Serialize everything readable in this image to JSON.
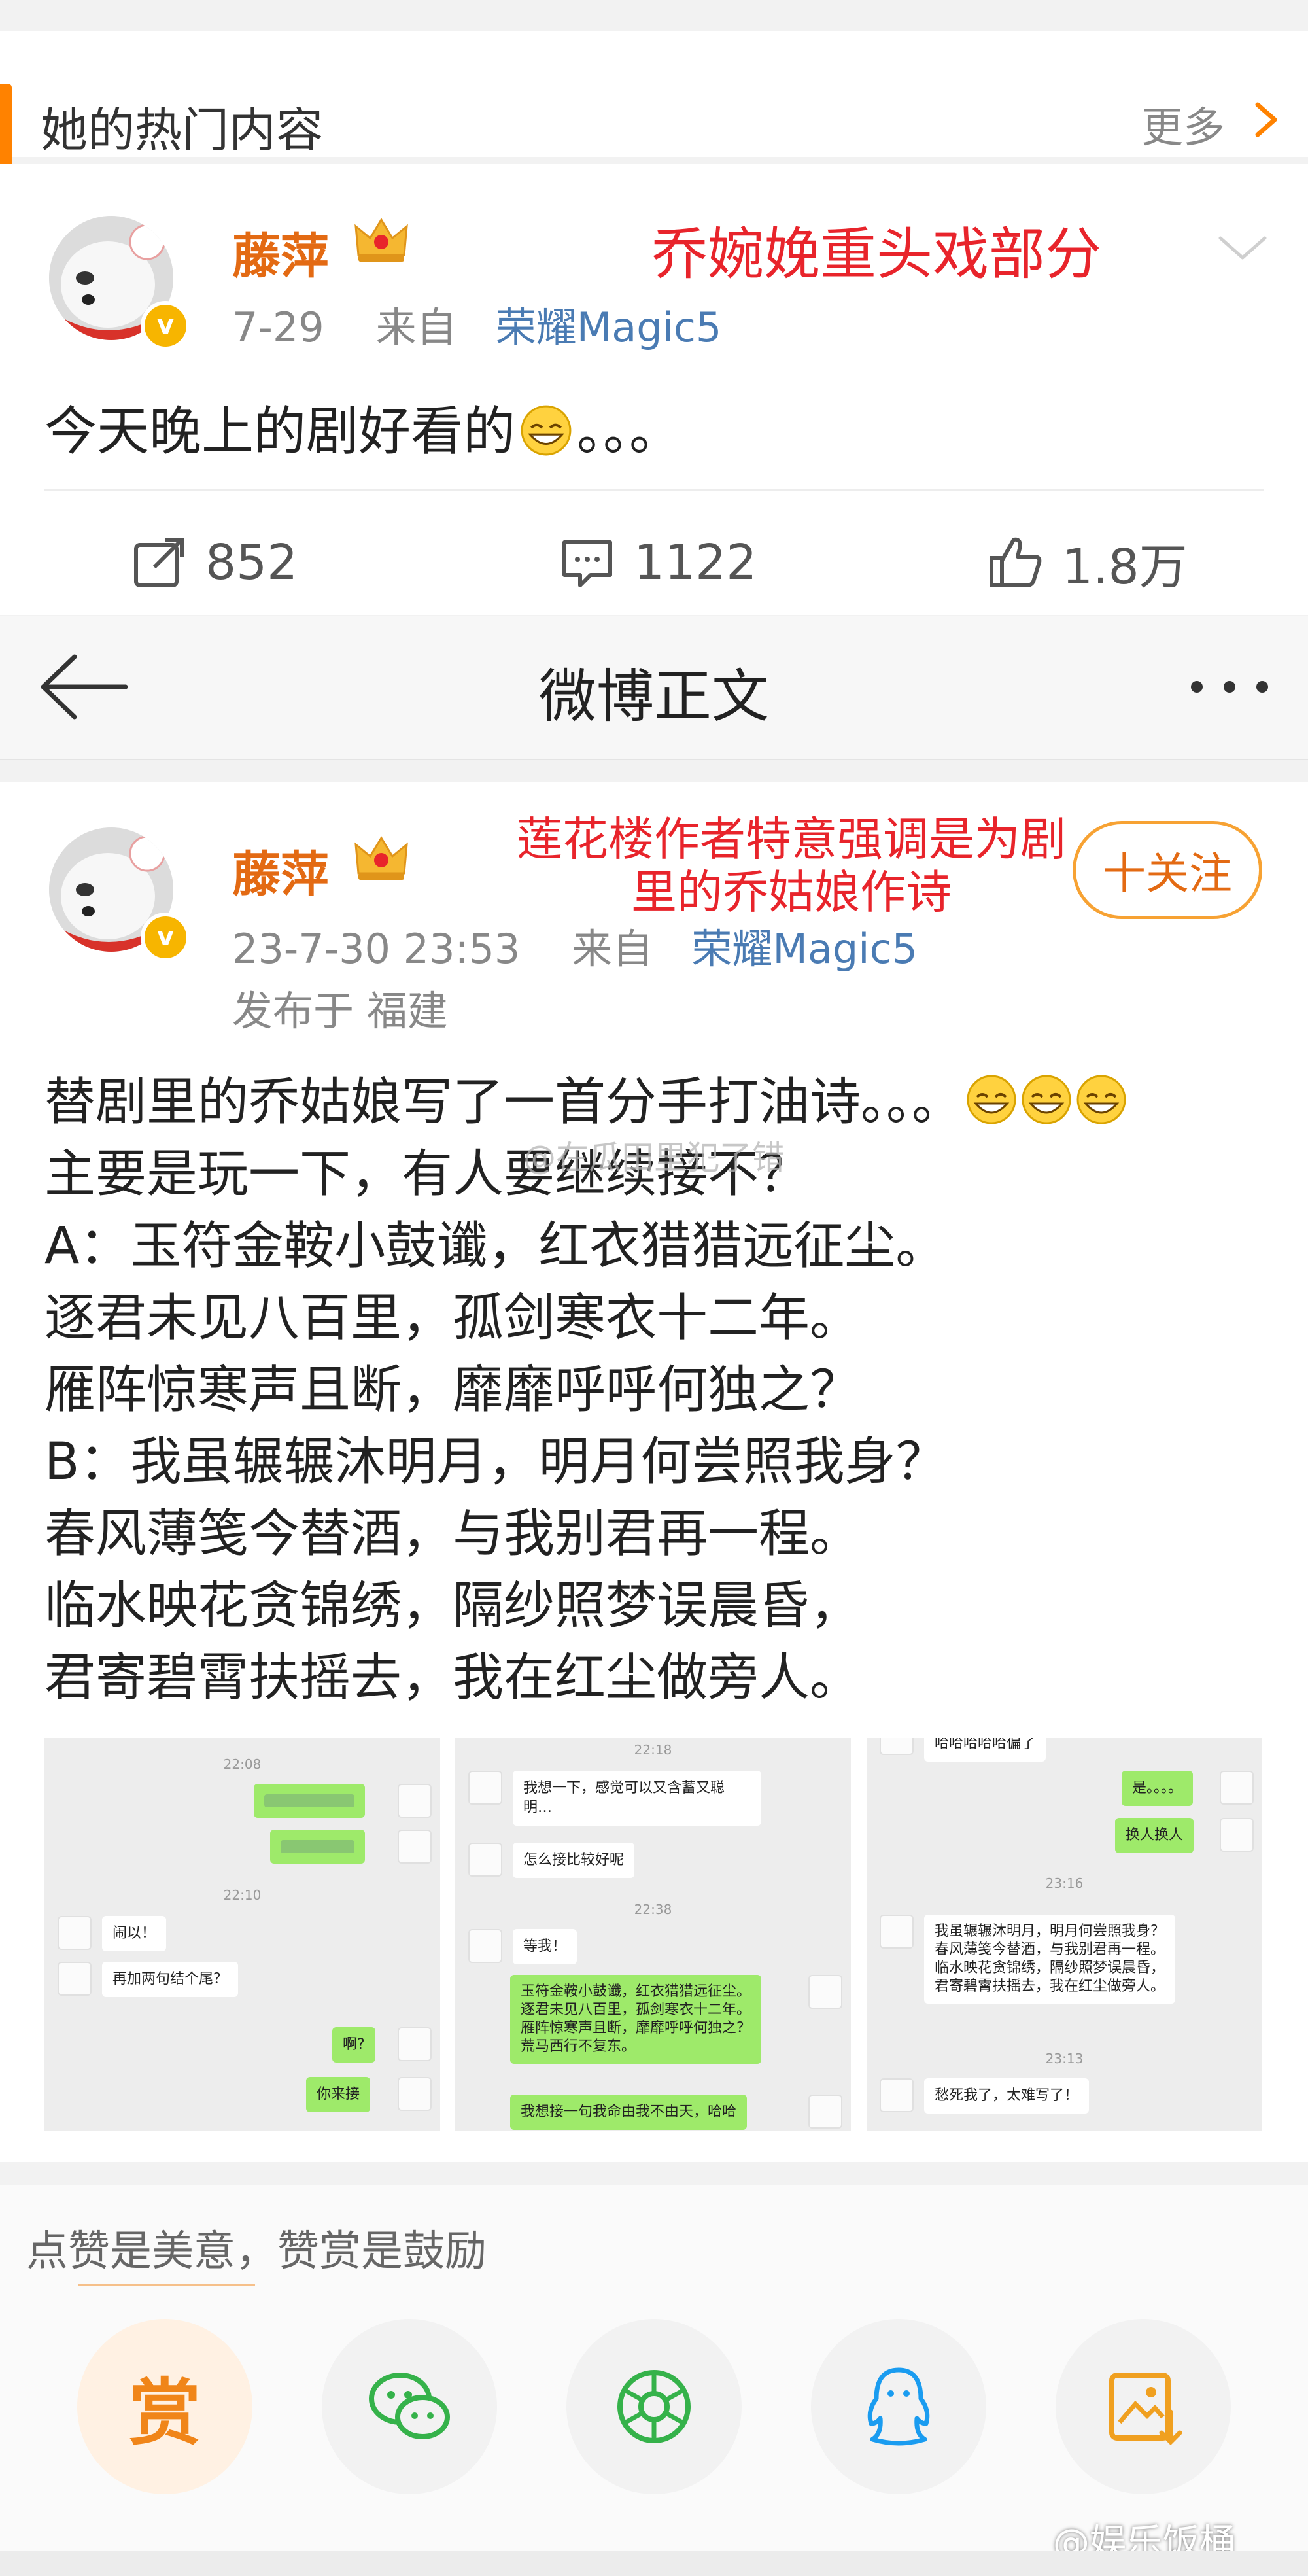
{
  "section": {
    "title": "她的热门内容",
    "more": "更多"
  },
  "post1": {
    "username": "藤萍",
    "time": "7-29",
    "from_word": "来自",
    "source": "荣耀Magic5",
    "annotation": "乔婉娩重头戏部分",
    "text": "今天晚上的剧好看的",
    "text_after": "。。。",
    "reposts": "852",
    "comments": "1122",
    "likes": "1.8万"
  },
  "nav": {
    "title": "微博正文"
  },
  "post2": {
    "username": "藤萍",
    "annotation": "莲花楼作者特意强调是为剧里的乔姑娘作诗",
    "follow": "十关注",
    "time": "23-7-30 23:53",
    "from_word": "来自",
    "source": "荣耀Magic5",
    "location": "发布于  福建",
    "lines": [
      "替剧里的乔姑娘写了一首分手打油诗。。。",
      "主要是玩一下，有人要继续接不？",
      "A：玉符金鞍小鼓谶，红衣猎猎远征尘。",
      "逐君未见八百里，孤剑寒衣十二年。",
      "雁阵惊寒声且断，靡靡呼呼何独之？",
      "B：我虽辗辗沐明月，明月何尝照我身？",
      "春风薄笺今替酒，与我别君再一程。",
      "临水映花贪锦绣，隔纱照梦误晨昏，",
      "君寄碧霄扶摇去，我在红尘做旁人。"
    ],
    "watermark": "@在瓜田里犯了错"
  },
  "chat1": {
    "t1": "22:08",
    "t2": "22:10",
    "m1": "闹以！",
    "m2": "再加两句结个尾？",
    "m3": "啊?",
    "m4": "你来接"
  },
  "chat2": {
    "t1": "22:18",
    "m1": "我想一下，感觉可以又含蓄又聪明…",
    "m2": "怎么接比较好呢",
    "t2": "22:38",
    "m3": "等我！",
    "m4": [
      "玉符金鞍小鼓谶，红衣猎猎远征尘。",
      "逐君未见八百里，孤剑寒衣十二年。",
      "雁阵惊寒声且断，靡靡呼呼何独之？",
      "荒马西行不复东。"
    ],
    "m5": "我想接一句我命由我不由天，哈哈"
  },
  "chat3": {
    "m0": "哈哈哈哈哈偏了",
    "m1": "是。。。。",
    "m2": "换人换人",
    "t1": "23:16",
    "m3": [
      "我虽辗辗沐明月，明月何尝照我身？",
      "春风薄笺今替酒，与我别君再一程。",
      "临水映花贪锦绣，隔纱照梦误晨昏，",
      "君寄碧霄扶摇去，我在红尘做旁人。"
    ],
    "t2": "23:13",
    "m4": "愁死我了，太难写了！"
  },
  "reward": {
    "text": "点赞是美意，赞赏是鼓励",
    "reward_label": "赏",
    "icons": [
      "wechat-icon",
      "moments-icon",
      "qq-icon",
      "save-image-icon"
    ]
  },
  "footer": {
    "watermark": "@娱乐饭桶"
  },
  "colors": {
    "accent": "#ff8200",
    "username": "#e36a13",
    "link": "#4a7bb3",
    "annotation": "#e8242b",
    "chat_green": "#9eea6a"
  }
}
